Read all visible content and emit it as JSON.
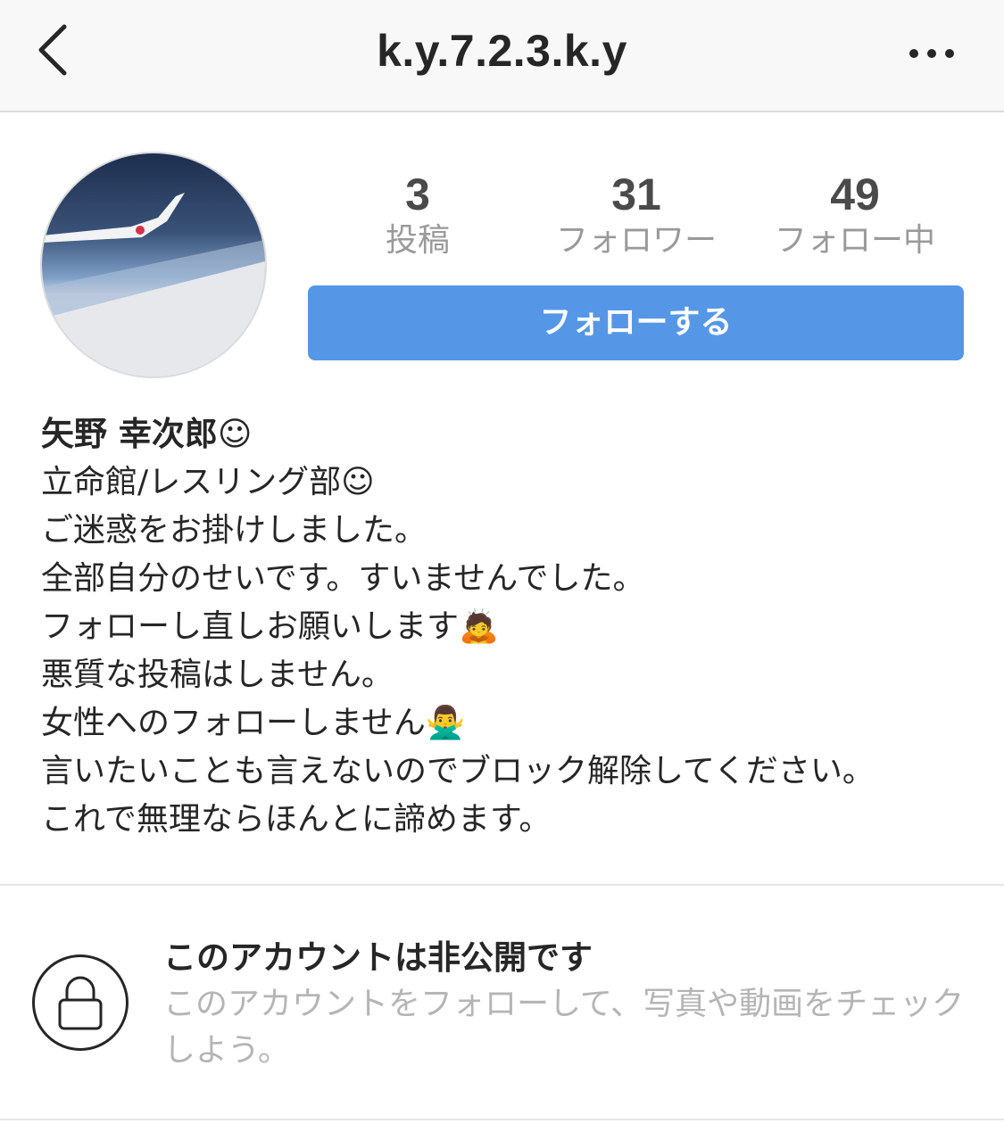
{
  "header": {
    "title": "k.y.7.2.3.k.y",
    "back_icon": "chevron-left-icon",
    "more_icon": "more-horizontal-icon"
  },
  "stats": [
    {
      "value": "3",
      "label": "投稿"
    },
    {
      "value": "31",
      "label": "フォロワー"
    },
    {
      "value": "49",
      "label": "フォロー中"
    }
  ],
  "follow_button": {
    "label": "フォローする",
    "color": "#5597e6"
  },
  "profile": {
    "name": "矢野 幸次郎☺",
    "bio_lines": [
      "立命館/レスリング部☺",
      "ご迷惑をお掛けしました。",
      "全部自分のせいです。すいませんでした。",
      "フォローし直しお願いします🙇",
      "悪質な投稿はしません。",
      "女性へのフォローしません🙅‍♂️",
      "言いたいことも言えないのでブロック解除してください。",
      "これで無理ならほんとに諦めます。"
    ]
  },
  "private": {
    "title": "このアカウントは非公開です",
    "description": "このアカウントをフォローして、写真や動画をチェックしよう。",
    "icon": "lock-icon"
  }
}
